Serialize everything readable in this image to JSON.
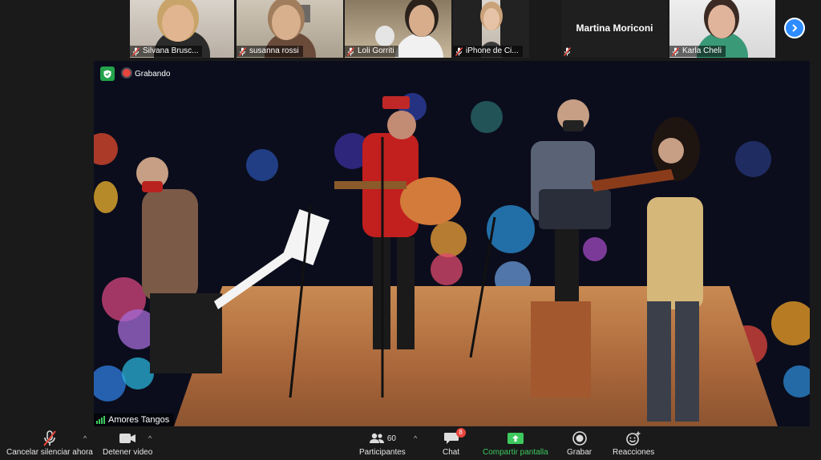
{
  "participants": [
    {
      "name": "Silvana Brusc...",
      "muted": true
    },
    {
      "name": "susanna rossi",
      "muted": true
    },
    {
      "name": "Loli Gorriti",
      "muted": true
    },
    {
      "name": "iPhone de Ci...",
      "muted": true
    },
    {
      "name": "Martina Moriconi",
      "muted": true,
      "video": false
    },
    {
      "name": "Karla Cheli",
      "muted": true
    }
  ],
  "main_video": {
    "recording_label": "Grabando",
    "speaker_name": "Amores Tangos"
  },
  "toolbar": {
    "unmute_label": "Cancelar silenciar ahora",
    "video_label": "Detener video",
    "participants_label": "Participantes",
    "participants_count": "60",
    "chat_label": "Chat",
    "chat_badge": "8",
    "share_label": "Compartir pantalla",
    "record_label": "Grabar",
    "reactions_label": "Reacciones"
  },
  "colors": {
    "background": "#1a1a1a",
    "accent_blue": "#2d8cff",
    "share_green": "#3ec95e",
    "recording_red": "#e8453c",
    "badge_red": "#e8453c"
  },
  "icons": [
    "mic-muted-icon",
    "video-camera-icon",
    "participants-icon",
    "chat-icon",
    "share-screen-icon",
    "record-icon",
    "reactions-icon",
    "shield-icon",
    "chevron-right-icon"
  ]
}
